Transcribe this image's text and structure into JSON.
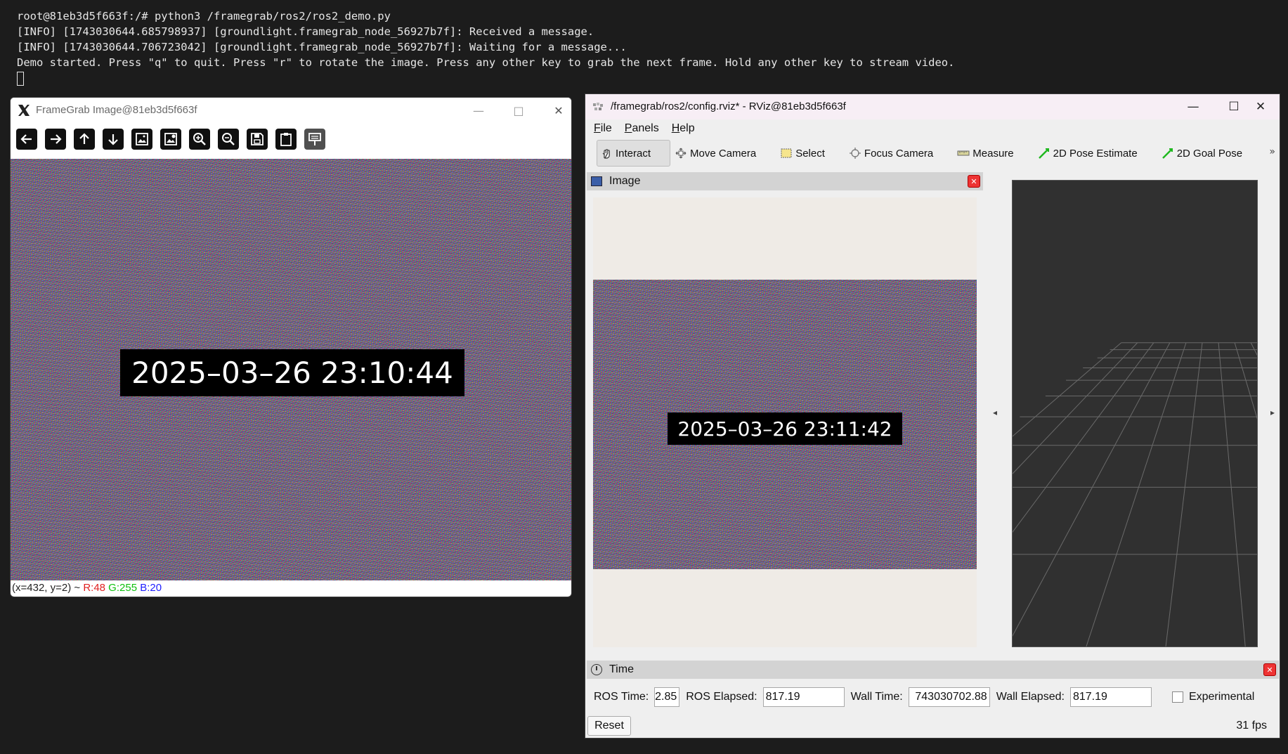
{
  "terminal": {
    "line1": "root@81eb3d5f663f:/# python3 /framegrab/ros2/ros2_demo.py",
    "line2": "[INFO] [1743030644.685798937] [groundlight.framegrab_node_56927b7f]: Received a message.",
    "line3": "[INFO] [1743030644.706723042] [groundlight.framegrab_node_56927b7f]: Waiting for a message...",
    "line4": "Demo started. Press \"q\" to quit. Press \"r\" to rotate the image. Press any other key to grab the next frame. Hold any other key to stream video."
  },
  "framegrab": {
    "title": "FrameGrab Image@81eb3d5f663f",
    "timestamp": "2025–03–26 23:10:44",
    "status": {
      "coords": "(x=432, y=2) ~ ",
      "r": "R:48",
      "g": "G:255",
      "b": "B:20"
    },
    "toolbar": [
      "arrow-left-icon",
      "arrow-right-icon",
      "arrow-up-icon",
      "arrow-down-icon",
      "image-icon",
      "image-settings-icon",
      "zoom-in-icon",
      "zoom-out-icon",
      "save-icon",
      "clipboard-icon",
      "properties-icon"
    ]
  },
  "rviz": {
    "title": "/framegrab/ros2/config.rviz* - RViz@81eb3d5f663f",
    "menu": {
      "file_u": "F",
      "file_rest": "ile",
      "panels_u": "P",
      "panels_rest": "anels",
      "help_u": "H",
      "help_rest": "elp"
    },
    "tools": {
      "interact": "Interact",
      "move_camera": "Move Camera",
      "select": "Select",
      "focus_camera": "Focus Camera",
      "measure": "Measure",
      "pose_estimate": "2D Pose Estimate",
      "goal_pose": "2D Goal Pose"
    },
    "image_panel_title": "Image",
    "timestamp": "2025–03–26 23:11:42",
    "time_panel": {
      "title": "Time",
      "ros_time_label": "ROS Time:",
      "ros_time_value": "2.85",
      "ros_elapsed_label": "ROS Elapsed:",
      "ros_elapsed_value": "817.19",
      "wall_time_label": "Wall Time:",
      "wall_time_value": "743030702.88",
      "wall_elapsed_label": "Wall Elapsed:",
      "wall_elapsed_value": "817.19",
      "experimental_label": "Experimental",
      "experimental_checked": false,
      "reset_label": "Reset",
      "fps": "31 fps"
    }
  },
  "colors": {
    "terminal_bg": "#1c1c1c",
    "pixel_r": "#e02020",
    "pixel_g": "#10c010",
    "pixel_b": "#2020ff",
    "grid_bg": "#303030",
    "panel_close": "#e33333"
  }
}
